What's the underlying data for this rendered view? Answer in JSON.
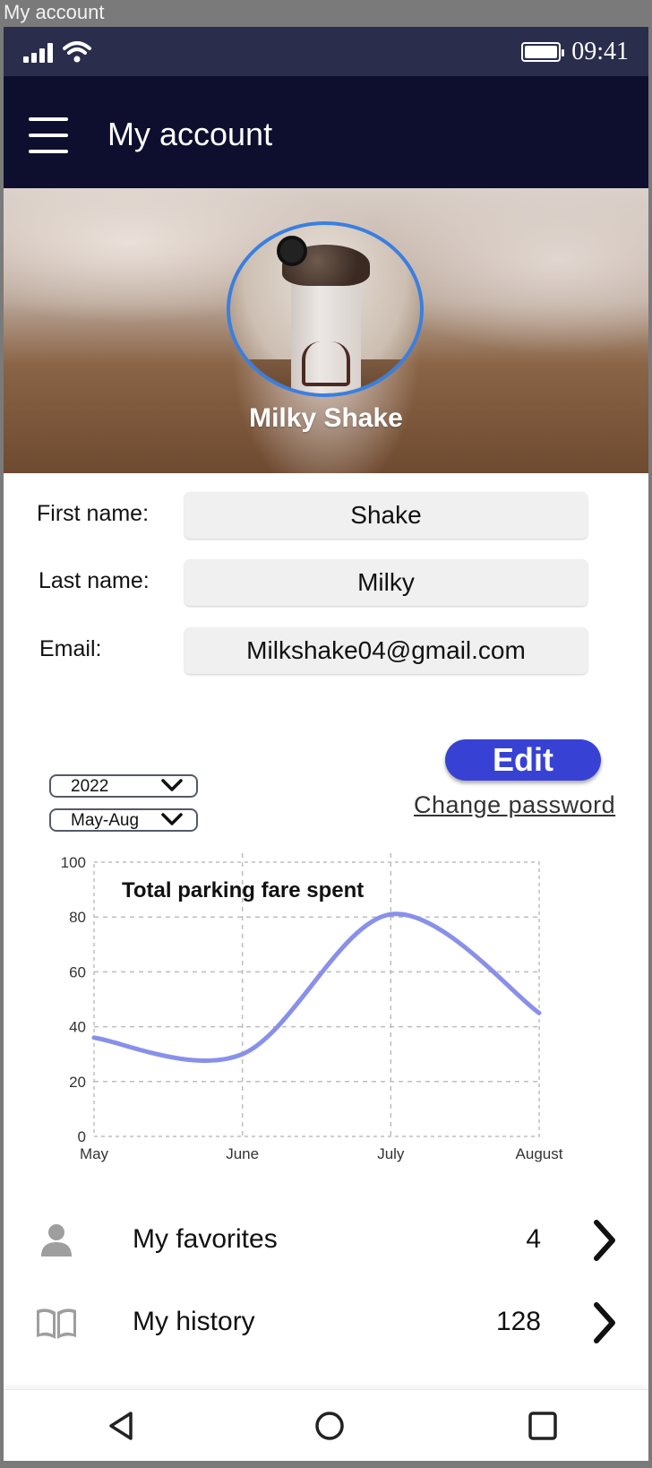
{
  "window": {
    "title": "My account"
  },
  "status_bar": {
    "time": "09:41"
  },
  "app_bar": {
    "title": "My account"
  },
  "profile": {
    "display_name": "Milky Shake"
  },
  "form": {
    "first_name_label": "First name:",
    "first_name_value": "Shake",
    "last_name_label": "Last name:",
    "last_name_value": "Milky",
    "email_label": "Email:",
    "email_value": "Milkshake04@gmail.com"
  },
  "actions": {
    "edit_label": "Edit",
    "change_password_label": "Change password"
  },
  "filters": {
    "year": "2022",
    "period": "May-Aug"
  },
  "chart_data": {
    "type": "line",
    "title": "Total parking fare spent",
    "xlabel": "",
    "ylabel": "",
    "categories": [
      "May",
      "June",
      "July",
      "August"
    ],
    "x": [
      0,
      1,
      2,
      3
    ],
    "series": [
      {
        "values": [
          36,
          30,
          81,
          45
        ],
        "color": "#8890ea"
      }
    ],
    "ylim": [
      0,
      100
    ],
    "yticks": [
      0,
      20,
      40,
      60,
      80,
      100
    ],
    "grid": true
  },
  "list": [
    {
      "label": "My favorites",
      "count": "4",
      "icon": "person-icon"
    },
    {
      "label": "My history",
      "count": "128",
      "icon": "book-icon"
    }
  ],
  "colors": {
    "app_bar": "#0e0f2e",
    "status_bar": "#2b2d4d",
    "accent": "#3742d4",
    "avatar_ring": "#3a7fe0",
    "chart_line": "#8890ea"
  }
}
